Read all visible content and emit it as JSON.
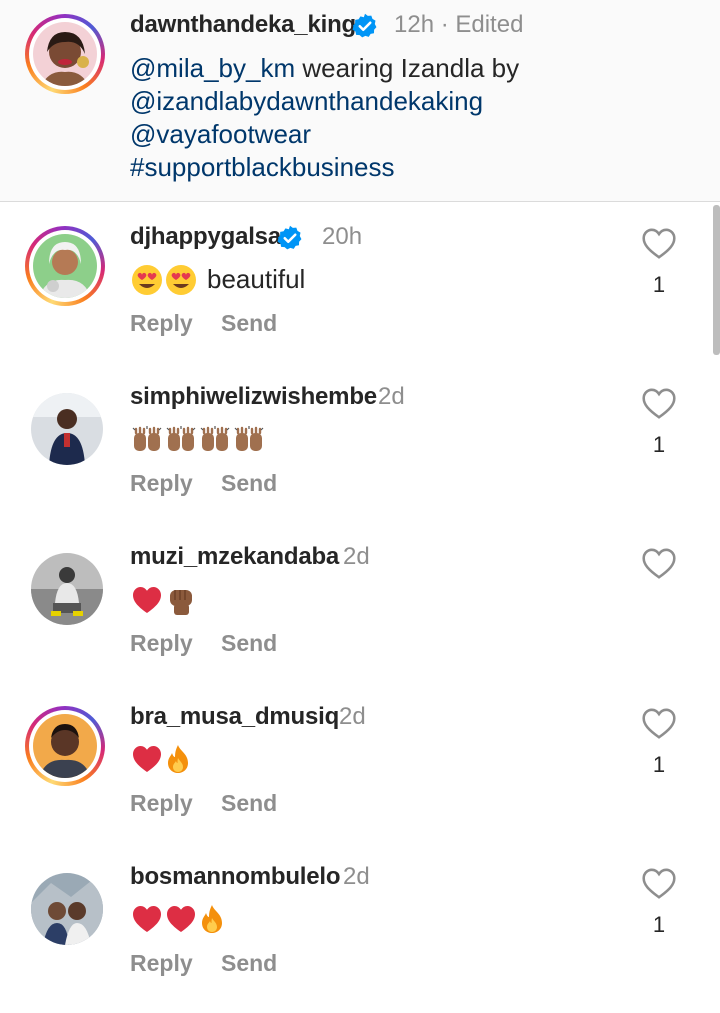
{
  "caption": {
    "username": "dawnthandeka_king",
    "time": "12h · Edited",
    "line1_mention": "@mila_by_km",
    "line1_text": " wearing Izandla by",
    "line2": "@izandlabydawnthandekaking",
    "line3": "@vayafootwear",
    "line4": "#supportblackbusiness"
  },
  "actions": {
    "reply": "Reply",
    "send": "Send"
  },
  "comments": [
    {
      "username": "djhappygalsa",
      "time": "20h",
      "verified": true,
      "text": "beautiful",
      "emojis": [
        "heart-eyes-emoji",
        "heart-eyes-emoji"
      ],
      "likes": "1",
      "avatar": "story-ring"
    },
    {
      "username": "simphiwelizwishembe",
      "time": "2d",
      "verified": false,
      "text": "",
      "emojis": [
        "raised-hands-emoji",
        "raised-hands-emoji",
        "raised-hands-emoji",
        "raised-hands-emoji"
      ],
      "likes": "1",
      "avatar": "plain"
    },
    {
      "username": "muzi_mzekandaba",
      "time": "2d",
      "verified": false,
      "text": "",
      "emojis": [
        "red-heart-emoji",
        "raised-fist-emoji"
      ],
      "likes": "",
      "avatar": "plain"
    },
    {
      "username": "bra_musa_dmusiq",
      "time": "2d",
      "verified": false,
      "text": "",
      "emojis": [
        "red-heart-emoji",
        "fire-emoji"
      ],
      "likes": "1",
      "avatar": "story-ring"
    },
    {
      "username": "bosmannombulelo",
      "time": "2d",
      "verified": false,
      "text": "",
      "emojis": [
        "red-heart-emoji",
        "red-heart-emoji",
        "fire-emoji"
      ],
      "likes": "1",
      "avatar": "plain"
    }
  ],
  "colors": {
    "link": "#00376b",
    "verified": "#0095f6",
    "muted": "#8e8e8e",
    "text": "#262626",
    "heart": "#e0245e"
  },
  "icons": {
    "verified": "verified-badge-icon",
    "like": "heart-outline-icon"
  }
}
